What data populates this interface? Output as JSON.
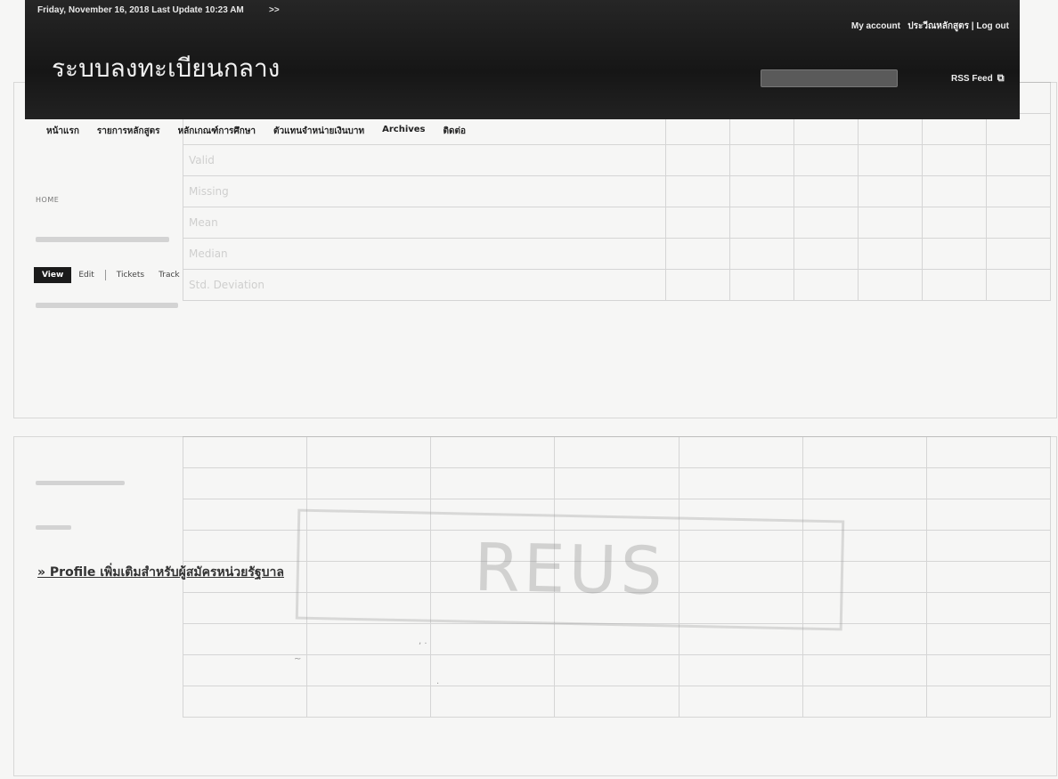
{
  "header": {
    "date_text": "Friday, November 16, 2018 Last Update 10:23 AM",
    "arrow": ">>",
    "account": "My account",
    "user": "ประวีณหลักสูตร",
    "logout": "Log out",
    "site_title": "ระบบลงทะเบียนกลาง",
    "rss": "RSS Feed"
  },
  "nav": {
    "items": [
      "หน้าแรก",
      "รายการหลักสูตร",
      "หลักเกณฑ์การศึกษา",
      "ตัวแทนจำหน่ายเงินบาท",
      "Archives",
      "ติดต่อ"
    ]
  },
  "breadcrumb": "HOME",
  "tabs": [
    "View",
    "Edit",
    "Tickets",
    "Track"
  ],
  "profile_link": "» Profile เพิ่มเติมสำหรับผู้สมัครหน่วยรัฐบาล",
  "stamp_text": "REUS",
  "ghost_rows": [
    "Valid",
    "Missing",
    "Mean",
    "Median",
    "Std. Deviation"
  ]
}
